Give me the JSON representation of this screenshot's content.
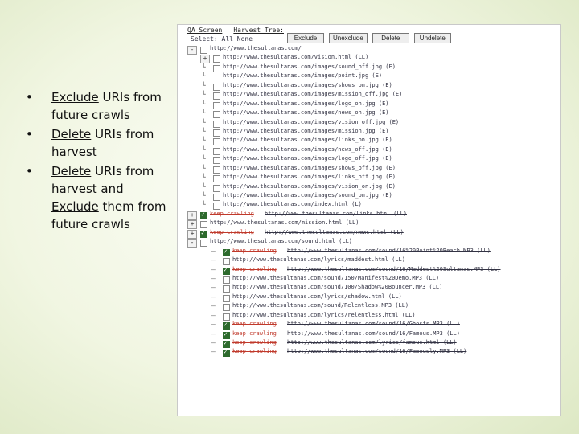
{
  "bullets": [
    {
      "parts": [
        {
          "t": "Exclude",
          "u": true
        },
        {
          "t": " URIs from future crawls",
          "u": false
        }
      ]
    },
    {
      "parts": [
        {
          "t": "Delete",
          "u": true
        },
        {
          "t": " URIs from harvest",
          "u": false
        }
      ]
    },
    {
      "parts": [
        {
          "t": "Delete",
          "u": true
        },
        {
          "t": " URIs from harvest and ",
          "u": false
        },
        {
          "t": "Exclude",
          "u": true
        },
        {
          "t": " them from future crawls",
          "u": false
        }
      ]
    }
  ],
  "screen": {
    "title_left": "QA Screen",
    "title_right": "Harvest Tree:",
    "select_label": "Select: All  None",
    "buttons": [
      "Exclude",
      "Unexclude",
      "Delete",
      "Undelete"
    ],
    "keep_label": "keep crawling",
    "rows": [
      {
        "level": 0,
        "tog": "-",
        "cb": true,
        "checked": false,
        "keep": false,
        "url": "http://www.thesultanas.com/"
      },
      {
        "level": 1,
        "tog": "+",
        "cb": true,
        "checked": false,
        "keep": false,
        "url": "http://www.thesultanas.com/vision.html  (LL)"
      },
      {
        "level": 1,
        "tog": "",
        "cb": true,
        "checked": false,
        "keep": false,
        "url": "http://www.thesultanas.com/images/sound_off.jpg  (E)"
      },
      {
        "level": 1,
        "tog": "",
        "cb": false,
        "checked": false,
        "keep": false,
        "url": "http://www.thesultanas.com/images/point.jpg  (E)"
      },
      {
        "level": 1,
        "tog": "",
        "cb": true,
        "checked": false,
        "keep": false,
        "url": "http://www.thesultanas.com/images/shows_on.jpg  (E)"
      },
      {
        "level": 1,
        "tog": "",
        "cb": true,
        "checked": false,
        "keep": false,
        "url": "http://www.thesultanas.com/images/mission_off.jpg  (E)"
      },
      {
        "level": 1,
        "tog": "",
        "cb": true,
        "checked": false,
        "keep": false,
        "url": "http://www.thesultanas.com/images/logo_on.jpg  (E)"
      },
      {
        "level": 1,
        "tog": "",
        "cb": true,
        "checked": false,
        "keep": false,
        "url": "http://www.thesultanas.com/images/news_on.jpg  (E)"
      },
      {
        "level": 1,
        "tog": "",
        "cb": true,
        "checked": false,
        "keep": false,
        "url": "http://www.thesultanas.com/images/vision_off.jpg  (E)"
      },
      {
        "level": 1,
        "tog": "",
        "cb": true,
        "checked": false,
        "keep": false,
        "url": "http://www.thesultanas.com/images/mission.jpg  (E)"
      },
      {
        "level": 1,
        "tog": "",
        "cb": true,
        "checked": false,
        "keep": false,
        "url": "http://www.thesultanas.com/images/links_on.jpg  (E)"
      },
      {
        "level": 1,
        "tog": "",
        "cb": true,
        "checked": false,
        "keep": false,
        "url": "http://www.thesultanas.com/images/news_off.jpg  (E)"
      },
      {
        "level": 1,
        "tog": "",
        "cb": true,
        "checked": false,
        "keep": false,
        "url": "http://www.thesultanas.com/images/logo_off.jpg  (E)"
      },
      {
        "level": 1,
        "tog": "",
        "cb": true,
        "checked": false,
        "keep": false,
        "url": "http://www.thesultanas.com/images/shows_off.jpg  (E)"
      },
      {
        "level": 1,
        "tog": "",
        "cb": true,
        "checked": false,
        "keep": false,
        "url": "http://www.thesultanas.com/images/links_off.jpg  (E)"
      },
      {
        "level": 1,
        "tog": "",
        "cb": true,
        "checked": false,
        "keep": false,
        "url": "http://www.thesultanas.com/images/vision_on.jpg  (E)"
      },
      {
        "level": 1,
        "tog": "",
        "cb": true,
        "checked": false,
        "keep": false,
        "url": "http://www.thesultanas.com/images/sound_on.jpg  (E)"
      },
      {
        "level": 1,
        "tog": "",
        "cb": true,
        "checked": false,
        "keep": false,
        "url": "http://www.thesultanas.com/index.html  (L)"
      },
      {
        "level": 0,
        "tog": "+",
        "cb": true,
        "checked": true,
        "keep": true,
        "url": "http://www.thesultanas.com/links.html  (LL)"
      },
      {
        "level": 0,
        "tog": "+",
        "cb": true,
        "checked": false,
        "keep": false,
        "url": "http://www.thesultanas.com/mission.html  (LL)"
      },
      {
        "level": 0,
        "tog": "+",
        "cb": true,
        "checked": true,
        "keep": true,
        "url": "http://www.thesultanas.com/news.html  (LL)"
      },
      {
        "level": 0,
        "tog": "-",
        "cb": true,
        "checked": false,
        "keep": false,
        "url": "http://www.thesultanas.com/sound.html  (LL)"
      },
      {
        "level": 2,
        "tog": "",
        "cb": true,
        "checked": true,
        "keep": true,
        "url": "http://www.thesultanas.com/sound/16%20Point%20Beach.MP3  (LL)"
      },
      {
        "level": 2,
        "tog": "",
        "cb": true,
        "checked": false,
        "keep": false,
        "url": "http://www.thesultanas.com/lyrics/maddest.html  (LL)"
      },
      {
        "level": 2,
        "tog": "",
        "cb": true,
        "checked": true,
        "keep": true,
        "url": "http://www.thesultanas.com/sound/16/Maddest%20Sultanas.MP3  (LL)"
      },
      {
        "level": 2,
        "tog": "",
        "cb": true,
        "checked": false,
        "keep": false,
        "url": "http://www.thesultanas.com/sound/150/Manifest%20Demo.MP3  (LL)"
      },
      {
        "level": 2,
        "tog": "",
        "cb": true,
        "checked": false,
        "keep": false,
        "url": "http://www.thesultanas.com/sound/100/Shadow%20Bouncer.MP3  (LL)"
      },
      {
        "level": 2,
        "tog": "",
        "cb": true,
        "checked": false,
        "keep": false,
        "url": "http://www.thesultanas.com/lyrics/shadow.html  (LL)"
      },
      {
        "level": 2,
        "tog": "",
        "cb": true,
        "checked": false,
        "keep": false,
        "url": "http://www.thesultanas.com/sound/Relentless.MP3  (LL)"
      },
      {
        "level": 2,
        "tog": "",
        "cb": true,
        "checked": false,
        "keep": false,
        "url": "http://www.thesultanas.com/lyrics/relentless.html  (LL)"
      },
      {
        "level": 2,
        "tog": "",
        "cb": true,
        "checked": true,
        "keep": true,
        "url": "http://www.thesultanas.com/sound/16/Ghosts.MP3  (LL)"
      },
      {
        "level": 2,
        "tog": "",
        "cb": true,
        "checked": true,
        "keep": true,
        "url": "http://www.thesultanas.com/sound/16/Famous.MP3  (LL)"
      },
      {
        "level": 2,
        "tog": "",
        "cb": true,
        "checked": true,
        "keep": true,
        "url": "http://www.thesultanas.com/lyrics/famous.html  (LL)"
      },
      {
        "level": 2,
        "tog": "",
        "cb": true,
        "checked": true,
        "keep": true,
        "url": "http://www.thesultanas.com/sound/16/Famously.MP3  (LL)"
      }
    ]
  }
}
